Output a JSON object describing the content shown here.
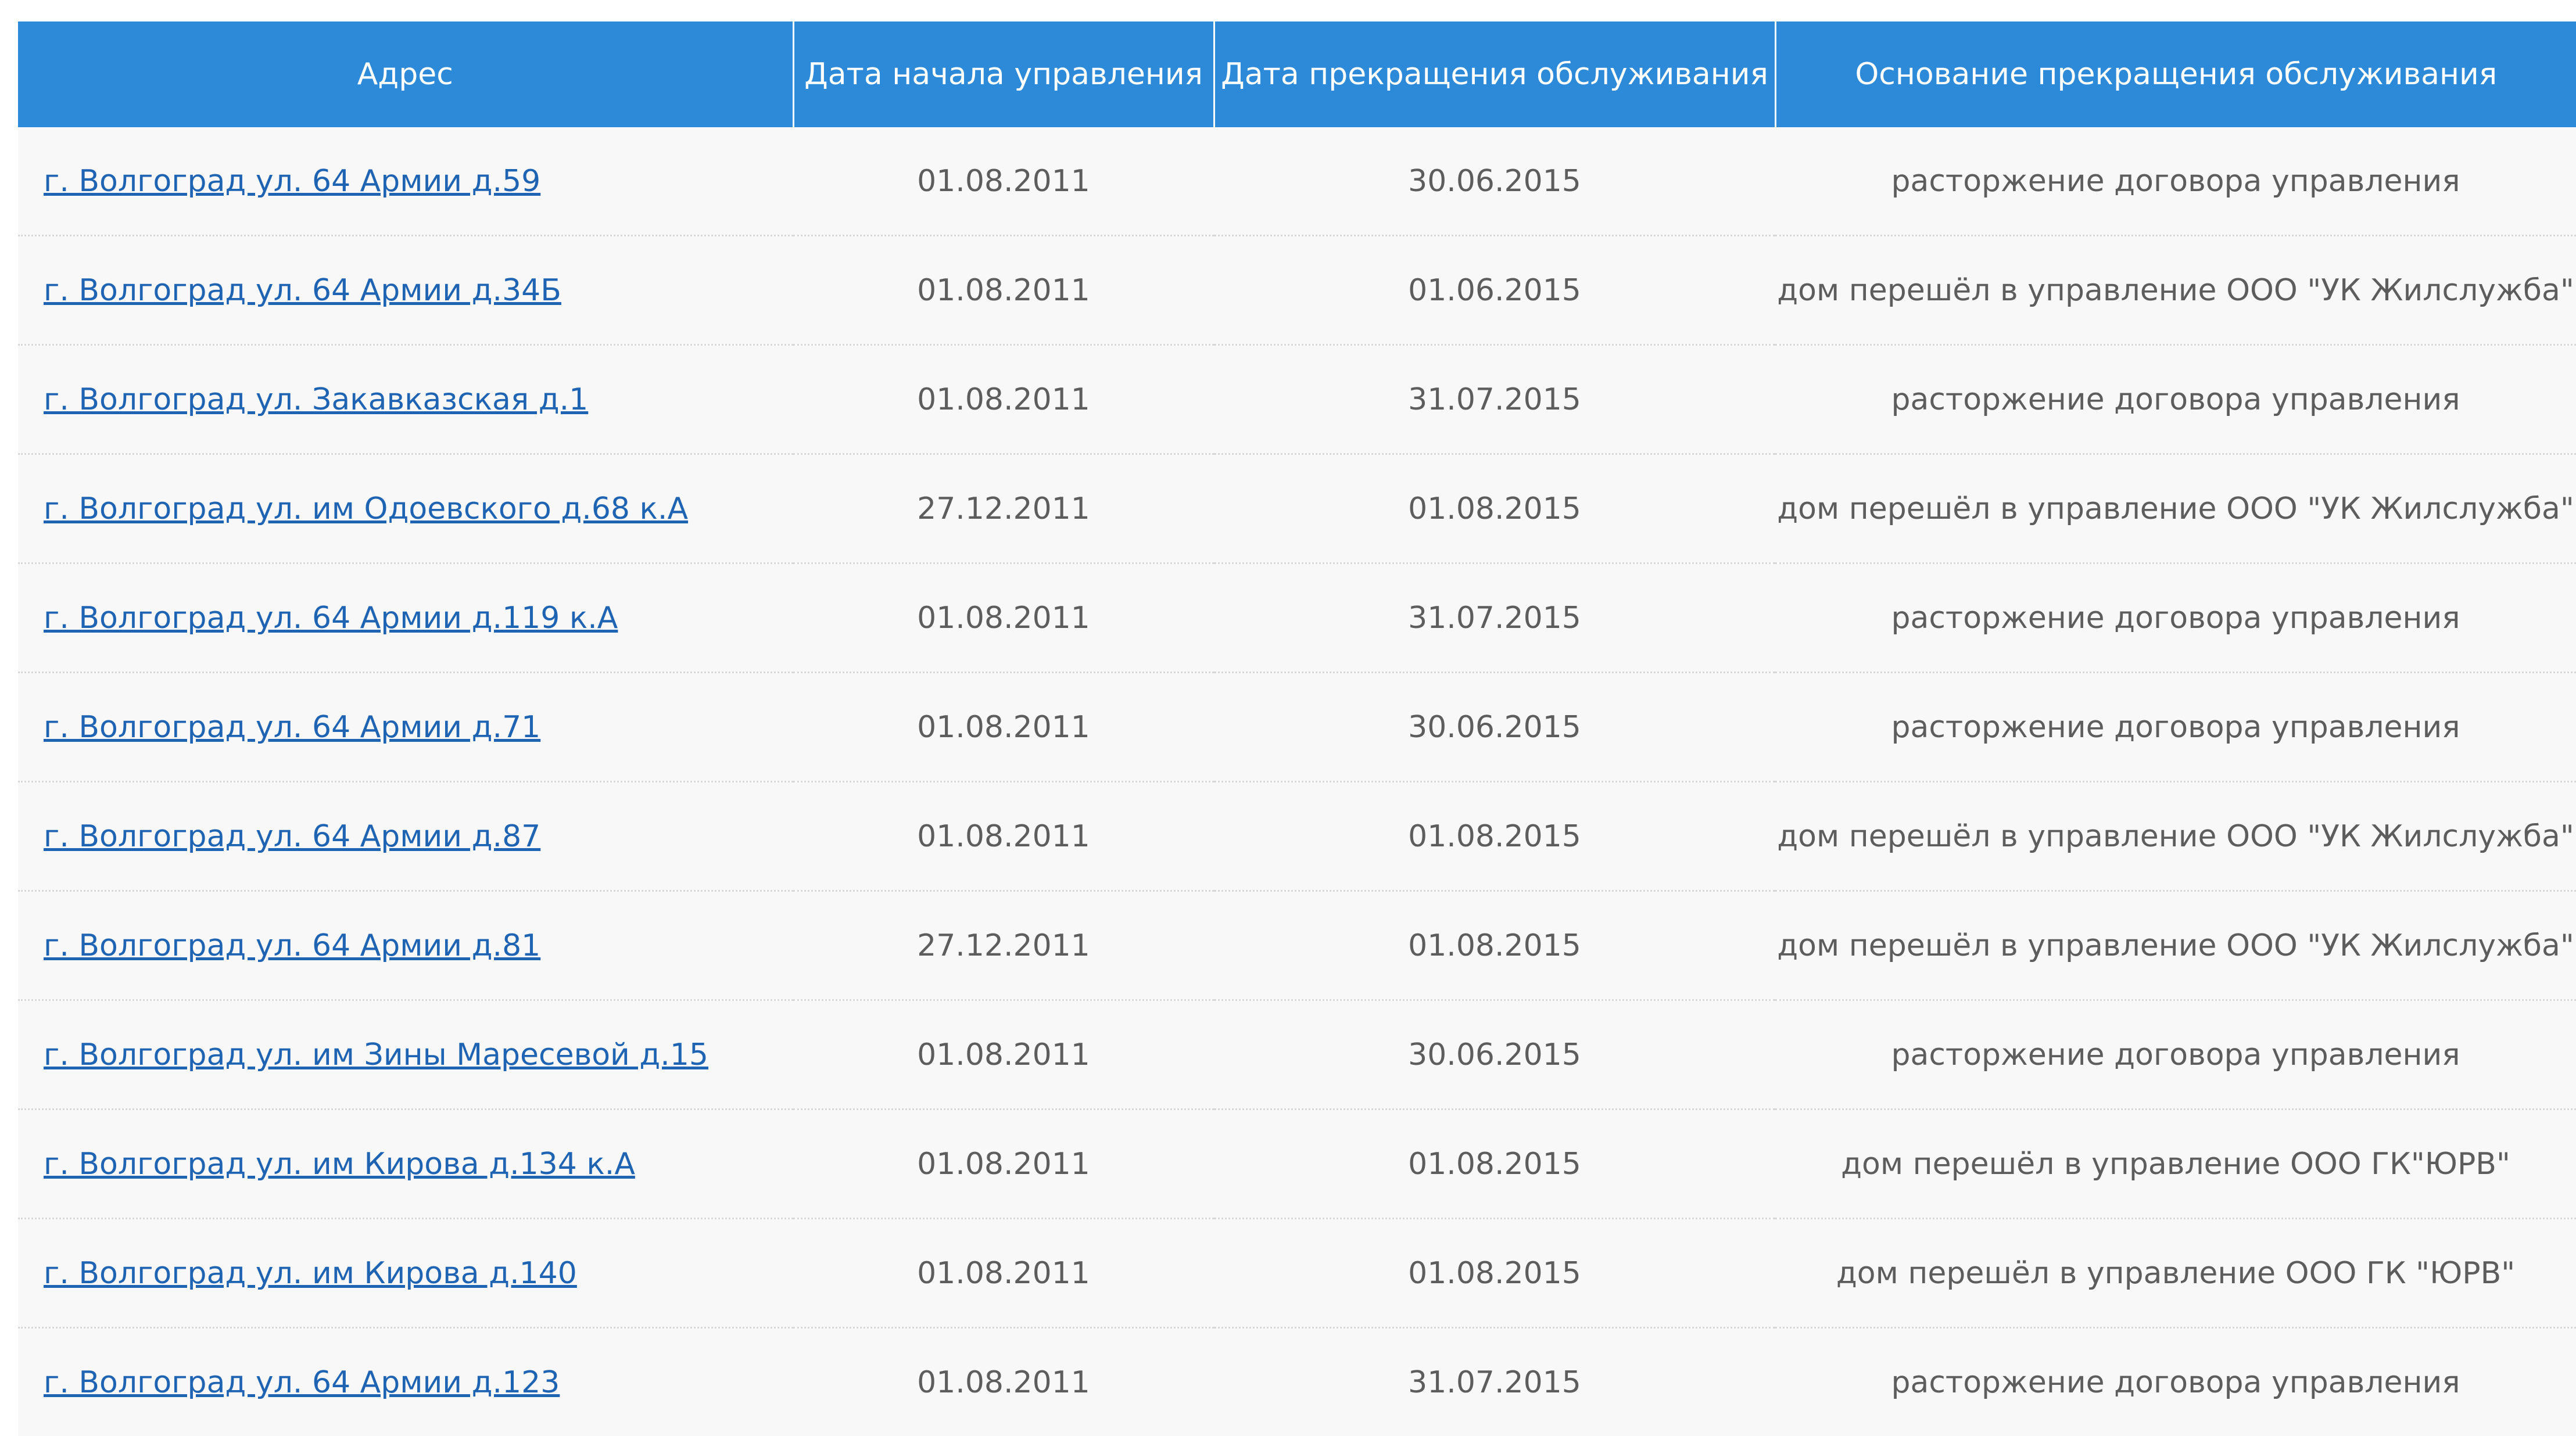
{
  "table": {
    "headers": [
      "Адрес",
      "Дата начала управления",
      "Дата прекращения обслуживания",
      "Основание прекращения обслуживания"
    ],
    "rows": [
      {
        "address": "г. Волгоград ул. 64 Армии д.59",
        "start": "01.08.2011",
        "end": "30.06.2015",
        "reason": "расторжение договора управления"
      },
      {
        "address": "г. Волгоград ул. 64 Армии д.34Б",
        "start": "01.08.2011",
        "end": "01.06.2015",
        "reason": "дом перешёл в управление ООО \"УК Жилслужба\""
      },
      {
        "address": "г. Волгоград ул. Закавказская д.1",
        "start": "01.08.2011",
        "end": "31.07.2015",
        "reason": "расторжение договора управления"
      },
      {
        "address": "г. Волгоград ул. им Одоевского д.68 к.А",
        "start": "27.12.2011",
        "end": "01.08.2015",
        "reason": "дом перешёл в управление ООО \"УК Жилслужба\""
      },
      {
        "address": "г. Волгоград ул. 64 Армии д.119 к.А",
        "start": "01.08.2011",
        "end": "31.07.2015",
        "reason": "расторжение договора управления"
      },
      {
        "address": "г. Волгоград ул. 64 Армии д.71",
        "start": "01.08.2011",
        "end": "30.06.2015",
        "reason": "расторжение договора управления"
      },
      {
        "address": "г. Волгоград ул. 64 Армии д.87",
        "start": "01.08.2011",
        "end": "01.08.2015",
        "reason": "дом перешёл в управление ООО \"УК Жилслужба\""
      },
      {
        "address": "г. Волгоград ул. 64 Армии д.81",
        "start": "27.12.2011",
        "end": "01.08.2015",
        "reason": "дом перешёл в управление ООО \"УК Жилслужба\""
      },
      {
        "address": "г. Волгоград ул. им Зины Маресевой д.15",
        "start": "01.08.2011",
        "end": "30.06.2015",
        "reason": "расторжение договора управления"
      },
      {
        "address": "г. Волгоград ул. им Кирова д.134 к.А",
        "start": "01.08.2011",
        "end": "01.08.2015",
        "reason": "дом перешёл в управление ООО ГК\"ЮРВ\""
      },
      {
        "address": "г. Волгоград ул. им Кирова д.140",
        "start": "01.08.2011",
        "end": "01.08.2015",
        "reason": "дом перешёл в управление ООО ГК \"ЮРВ\""
      },
      {
        "address": "г. Волгоград ул. 64 Армии д.123",
        "start": "01.08.2011",
        "end": "31.07.2015",
        "reason": "расторжение договора управления"
      }
    ]
  },
  "colors": {
    "header_bg": "#2d8ad8",
    "header_text": "#ffffff",
    "link": "#1f64b3",
    "cell_text": "#5d5d5d",
    "row_bg": "#f8f8f8"
  }
}
